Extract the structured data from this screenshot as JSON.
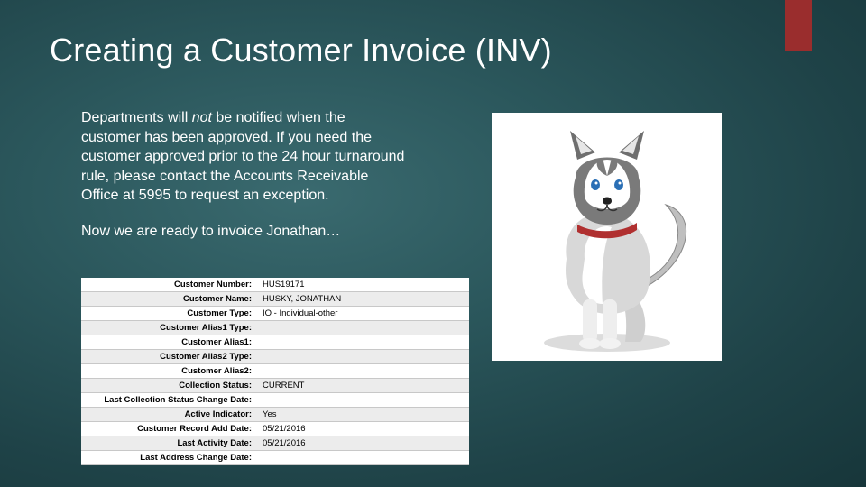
{
  "title": "Creating a Customer Invoice (INV)",
  "body": {
    "p1_pre": "Departments will ",
    "p1_not": "not",
    "p1_post": " be notified when the customer has been approved.  If you need the customer approved prior to the 24 hour turnaround rule, please contact the Accounts Receivable Office at 5995 to request an exception.",
    "p2": "Now we are ready to invoice Jonathan…"
  },
  "customer_table": {
    "rows": [
      {
        "label": "Customer Number:",
        "value": "HUS19171"
      },
      {
        "label": "Customer Name:",
        "value": "HUSKY, JONATHAN"
      },
      {
        "label": "Customer Type:",
        "value": "IO - Individual-other"
      },
      {
        "label": "Customer Alias1 Type:",
        "value": ""
      },
      {
        "label": "Customer Alias1:",
        "value": ""
      },
      {
        "label": "Customer Alias2 Type:",
        "value": ""
      },
      {
        "label": "Customer Alias2:",
        "value": ""
      },
      {
        "label": "Collection Status:",
        "value": "CURRENT"
      },
      {
        "label": "Last Collection Status Change Date:",
        "value": ""
      },
      {
        "label": "Active Indicator:",
        "value": "Yes"
      },
      {
        "label": "Customer Record Add Date:",
        "value": "05/21/2016"
      },
      {
        "label": "Last Activity Date:",
        "value": "05/21/2016"
      },
      {
        "label": "Last Address Change Date:",
        "value": ""
      }
    ]
  },
  "image": {
    "alt": "Husky puppy sitting"
  },
  "colors": {
    "accent": "#9a2d2d"
  }
}
